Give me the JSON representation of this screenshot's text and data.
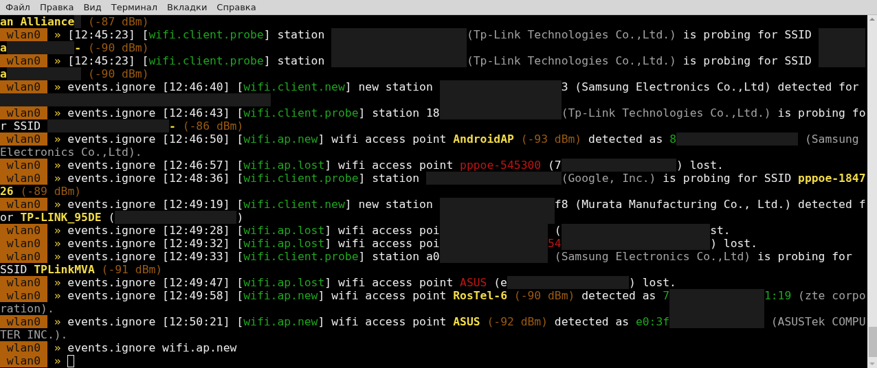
{
  "menu": [
    "Файл",
    "Правка",
    "Вид",
    "Терминал",
    "Вкладки",
    "Справка"
  ],
  "terminal": {
    "lines": [
      {
        "segments": [
          {
            "kind": "ssid",
            "text": "an Alliance"
          },
          {
            "kind": "redacted"
          },
          {
            "kind": "rssi",
            "text": " (-87 dBm)"
          }
        ]
      },
      {
        "segments": [
          {
            "kind": "iface",
            "text": "wlan0"
          },
          {
            "kind": "arrow",
            "text": "»"
          },
          {
            "kind": "plain",
            "text": "[12:45:23] ["
          },
          {
            "kind": "tag",
            "text": "wifi.client.probe"
          },
          {
            "kind": "plain",
            "text": "] station "
          },
          {
            "kind": "redacted"
          },
          {
            "kind": "vendor",
            "text": "(Tp-Link Technologies Co.,Ltd.)"
          },
          {
            "kind": "plain",
            "text": " is probing for SSID "
          },
          {
            "kind": "redacted"
          }
        ]
      },
      {
        "segments": [
          {
            "kind": "ssid",
            "text": "a"
          },
          {
            "kind": "redacted"
          },
          {
            "kind": "ssid",
            "text": "-"
          },
          {
            "kind": "rssi",
            "text": " (-90 dBm)"
          }
        ]
      },
      {
        "segments": [
          {
            "kind": "iface",
            "text": "wlan0"
          },
          {
            "kind": "arrow",
            "text": "»"
          },
          {
            "kind": "plain",
            "text": "[12:45:23] ["
          },
          {
            "kind": "tag",
            "text": "wifi.client.probe"
          },
          {
            "kind": "plain",
            "text": "] station "
          },
          {
            "kind": "redacted"
          },
          {
            "kind": "vendor",
            "text": "(Tp-Link Technologies Co.,Ltd.)"
          },
          {
            "kind": "plain",
            "text": " is probing for SSID "
          },
          {
            "kind": "redacted"
          }
        ]
      },
      {
        "segments": [
          {
            "kind": "ssid",
            "text": "a"
          },
          {
            "kind": "redacted"
          },
          {
            "kind": "rssi",
            "text": " (-90 dBm)"
          }
        ]
      },
      {
        "segments": [
          {
            "kind": "iface",
            "text": "wlan0"
          },
          {
            "kind": "arrow",
            "text": "»"
          },
          {
            "kind": "plain",
            "text": "events.ignore [12:46:40] ["
          },
          {
            "kind": "tag",
            "text": "wifi.client.new"
          },
          {
            "kind": "plain",
            "text": "] new station "
          },
          {
            "kind": "redacted"
          },
          {
            "kind": "plain",
            "text": "3 (Samsung Electronics Co.,Ltd) detected for"
          }
        ]
      },
      {
        "segments": [
          {
            "kind": "redacted"
          }
        ]
      },
      {
        "segments": [
          {
            "kind": "iface",
            "text": "wlan0"
          },
          {
            "kind": "arrow",
            "text": "»"
          },
          {
            "kind": "plain",
            "text": "events.ignore [12:46:43] ["
          },
          {
            "kind": "tag",
            "text": "wifi.client.probe"
          },
          {
            "kind": "plain",
            "text": "] station 18"
          },
          {
            "kind": "redacted"
          },
          {
            "kind": "vendor",
            "text": "(Tp-Link Technologies Co.,Ltd.)"
          },
          {
            "kind": "plain",
            "text": " is probing fo"
          }
        ]
      },
      {
        "segments": [
          {
            "kind": "plain",
            "text": "r SSID "
          },
          {
            "kind": "redacted"
          },
          {
            "kind": "ssid",
            "text": "-"
          },
          {
            "kind": "rssi",
            "text": " (-86 dBm)"
          }
        ]
      },
      {
        "segments": [
          {
            "kind": "iface",
            "text": "wlan0"
          },
          {
            "kind": "arrow",
            "text": "»"
          },
          {
            "kind": "plain",
            "text": "events.ignore [12:46:50] ["
          },
          {
            "kind": "tag",
            "text": "wifi.ap.new"
          },
          {
            "kind": "plain",
            "text": "] wifi access point "
          },
          {
            "kind": "ssid",
            "text": "AndroidAP"
          },
          {
            "kind": "rssi",
            "text": " (-93 dBm)"
          },
          {
            "kind": "plain",
            "text": " detected as "
          },
          {
            "kind": "mac",
            "text": "8"
          },
          {
            "kind": "redacted"
          },
          {
            "kind": "vendor",
            "text": " (Samsung"
          }
        ]
      },
      {
        "segments": [
          {
            "kind": "vendor",
            "text": "Electronics Co.,Ltd)."
          }
        ]
      },
      {
        "segments": [
          {
            "kind": "iface",
            "text": "wlan0"
          },
          {
            "kind": "arrow",
            "text": "»"
          },
          {
            "kind": "plain",
            "text": "events.ignore [12:46:57] ["
          },
          {
            "kind": "tag",
            "text": "wifi.ap.lost"
          },
          {
            "kind": "plain",
            "text": "] wifi access point "
          },
          {
            "kind": "lost",
            "text": "pppoe-545300"
          },
          {
            "kind": "plain",
            "text": " (7"
          },
          {
            "kind": "redacted"
          },
          {
            "kind": "plain",
            "text": ") lost."
          }
        ]
      },
      {
        "segments": [
          {
            "kind": "iface",
            "text": "wlan0"
          },
          {
            "kind": "arrow",
            "text": "»"
          },
          {
            "kind": "plain",
            "text": "events.ignore [12:48:36] ["
          },
          {
            "kind": "tag",
            "text": "wifi.client.probe"
          },
          {
            "kind": "plain",
            "text": "] station "
          },
          {
            "kind": "redacted"
          },
          {
            "kind": "vendor",
            "text": "(Google, Inc.)"
          },
          {
            "kind": "plain",
            "text": " is probing for SSID "
          },
          {
            "kind": "ssid",
            "text": "pppoe-1847"
          }
        ]
      },
      {
        "segments": [
          {
            "kind": "ssid",
            "text": "26"
          },
          {
            "kind": "rssi",
            "text": " (-89 dBm)"
          }
        ]
      },
      {
        "segments": [
          {
            "kind": "iface",
            "text": "wlan0"
          },
          {
            "kind": "arrow",
            "text": "»"
          },
          {
            "kind": "plain",
            "text": "events.ignore [12:49:19] ["
          },
          {
            "kind": "tag",
            "text": "wifi.client.new"
          },
          {
            "kind": "plain",
            "text": "] new station "
          },
          {
            "kind": "redacted"
          },
          {
            "kind": "plain",
            "text": "f8 (Murata Manufacturing Co., Ltd.) detected f"
          }
        ]
      },
      {
        "segments": [
          {
            "kind": "plain",
            "text": "or "
          },
          {
            "kind": "ssid",
            "text": "TP-LINK_95DE"
          },
          {
            "kind": "plain",
            "text": " ("
          },
          {
            "kind": "redacted"
          },
          {
            "kind": "plain",
            "text": ")"
          }
        ]
      },
      {
        "segments": [
          {
            "kind": "iface",
            "text": "wlan0"
          },
          {
            "kind": "arrow",
            "text": "»"
          },
          {
            "kind": "plain",
            "text": "events.ignore [12:49:28] ["
          },
          {
            "kind": "tag",
            "text": "wifi.ap.lost"
          },
          {
            "kind": "plain",
            "text": "] wifi access poi"
          },
          {
            "kind": "redacted"
          },
          {
            "kind": "plain",
            "text": " ("
          },
          {
            "kind": "redacted"
          },
          {
            "kind": "plain",
            "text": "st."
          }
        ]
      },
      {
        "segments": [
          {
            "kind": "iface",
            "text": "wlan0"
          },
          {
            "kind": "arrow",
            "text": "»"
          },
          {
            "kind": "plain",
            "text": "events.ignore [12:49:32] ["
          },
          {
            "kind": "tag",
            "text": "wifi.ap.lost"
          },
          {
            "kind": "plain",
            "text": "] wifi access poi"
          },
          {
            "kind": "redacted"
          },
          {
            "kind": "lost",
            "text": "54"
          },
          {
            "kind": "redacted"
          },
          {
            "kind": "plain",
            "text": ") lost."
          }
        ]
      },
      {
        "segments": [
          {
            "kind": "iface",
            "text": "wlan0"
          },
          {
            "kind": "arrow",
            "text": "»"
          },
          {
            "kind": "plain",
            "text": "events.ignore [12:49:33] ["
          },
          {
            "kind": "tag",
            "text": "wifi.client.probe"
          },
          {
            "kind": "plain",
            "text": "] station a0"
          },
          {
            "kind": "redacted"
          },
          {
            "kind": "vendor",
            "text": " (Samsung Electronics Co.,Ltd)"
          },
          {
            "kind": "plain",
            "text": " is probing for"
          }
        ]
      },
      {
        "segments": [
          {
            "kind": "plain",
            "text": "SSID "
          },
          {
            "kind": "ssid",
            "text": "TPLinkMVA"
          },
          {
            "kind": "rssi",
            "text": " (-91 dBm)"
          }
        ]
      },
      {
        "segments": [
          {
            "kind": "iface",
            "text": "wlan0"
          },
          {
            "kind": "arrow",
            "text": "»"
          },
          {
            "kind": "plain",
            "text": "events.ignore [12:49:47] ["
          },
          {
            "kind": "tag",
            "text": "wifi.ap.lost"
          },
          {
            "kind": "plain",
            "text": "] wifi access point "
          },
          {
            "kind": "lost",
            "text": "ASUS"
          },
          {
            "kind": "plain",
            "text": " (e"
          },
          {
            "kind": "redacted"
          },
          {
            "kind": "plain",
            "text": ") lost."
          }
        ]
      },
      {
        "segments": [
          {
            "kind": "iface",
            "text": "wlan0"
          },
          {
            "kind": "arrow",
            "text": "»"
          },
          {
            "kind": "plain",
            "text": "events.ignore [12:49:58] ["
          },
          {
            "kind": "tag",
            "text": "wifi.ap.new"
          },
          {
            "kind": "plain",
            "text": "] wifi access point "
          },
          {
            "kind": "ssid",
            "text": "RosTel-6"
          },
          {
            "kind": "rssi",
            "text": " (-90 dBm)"
          },
          {
            "kind": "plain",
            "text": " detected as "
          },
          {
            "kind": "mac",
            "text": "7"
          },
          {
            "kind": "redacted"
          },
          {
            "kind": "mac",
            "text": "1:19"
          },
          {
            "kind": "vendor",
            "text": " (zte corpo"
          }
        ]
      },
      {
        "segments": [
          {
            "kind": "vendor",
            "text": "ration)."
          }
        ]
      },
      {
        "segments": [
          {
            "kind": "iface",
            "text": "wlan0"
          },
          {
            "kind": "arrow",
            "text": "»"
          },
          {
            "kind": "plain",
            "text": "events.ignore [12:50:21] ["
          },
          {
            "kind": "tag",
            "text": "wifi.ap.new"
          },
          {
            "kind": "plain",
            "text": "] wifi access point "
          },
          {
            "kind": "ssid",
            "text": "ASUS"
          },
          {
            "kind": "rssi",
            "text": " (-92 dBm)"
          },
          {
            "kind": "plain",
            "text": " detected as "
          },
          {
            "kind": "mac",
            "text": "e0:3f"
          },
          {
            "kind": "redacted"
          },
          {
            "kind": "vendor",
            "text": " (ASUSTek COMPU"
          }
        ]
      },
      {
        "segments": [
          {
            "kind": "vendor",
            "text": "TER INC.)."
          }
        ]
      },
      {
        "segments": [
          {
            "kind": "iface",
            "text": "wlan0"
          },
          {
            "kind": "arrow",
            "text": "»"
          },
          {
            "kind": "plain",
            "text": "events.ignore wifi.ap.new"
          }
        ]
      },
      {
        "segments": [
          {
            "kind": "iface",
            "text": "wlan0"
          },
          {
            "kind": "arrow",
            "text": "»"
          },
          {
            "kind": "cursor"
          }
        ]
      }
    ]
  }
}
